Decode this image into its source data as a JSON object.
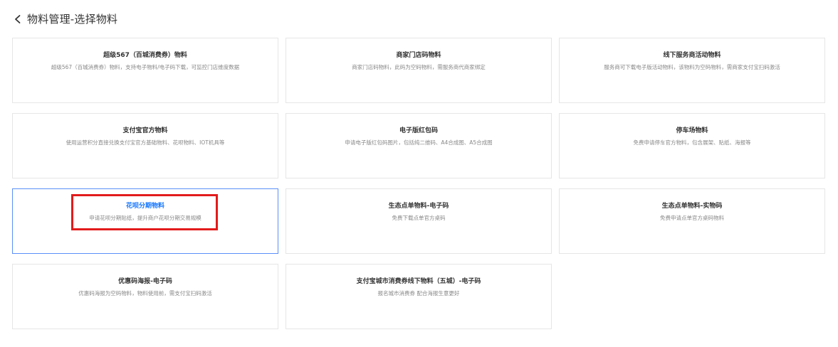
{
  "header": {
    "title": "物料管理-选择物料"
  },
  "cards": [
    {
      "title": "超级567（百城消费券）物料",
      "desc": "超级567（百城消费券）物料，支持电子物料/电子码下载，可监控门店维度数据"
    },
    {
      "title": "商家门店码物料",
      "desc": "商家门店码物料，此码为空码物料，需服务商代商家绑定"
    },
    {
      "title": "线下服务商活动物料",
      "desc": "服务商可下载电子版活动物料，该物料为空码物料，需商家支付宝扫码激活"
    },
    {
      "title": "支付宝官方物料",
      "desc": "使用运营积分直接兑换支付宝官方基础物料、花呗物料、IOT机具等"
    },
    {
      "title": "电子版红包码",
      "desc": "申请电子版红包码图片，包括纯二维码、A4合成图、A5合成图"
    },
    {
      "title": "停车场物料",
      "desc": "免费申请停车官方物料，包含展架、贴纸、海报等"
    },
    {
      "title": "花呗分期物料",
      "desc": "申请花呗分期贴纸，提升商户花呗分期交易规模"
    },
    {
      "title": "生态点单物料-电子码",
      "desc": "免费下载点单官方桌码"
    },
    {
      "title": "生态点单物料-实物码",
      "desc": "免费申请点单官方桌码物料"
    },
    {
      "title": "优惠码海报-电子码",
      "desc": "优惠码海报为空码物料，物料使用前，需支付宝扫码激活"
    },
    {
      "title": "支付宝城市消费券线下物料（五城）-电子码",
      "desc": "报名城市消费券 配合海报生意更好"
    }
  ],
  "colors": {
    "selected_border": "#5b8ff9",
    "selected_title": "#1677ff",
    "highlight_box": "#e21b1b"
  },
  "icons": {
    "back": "chevron-left-icon"
  }
}
